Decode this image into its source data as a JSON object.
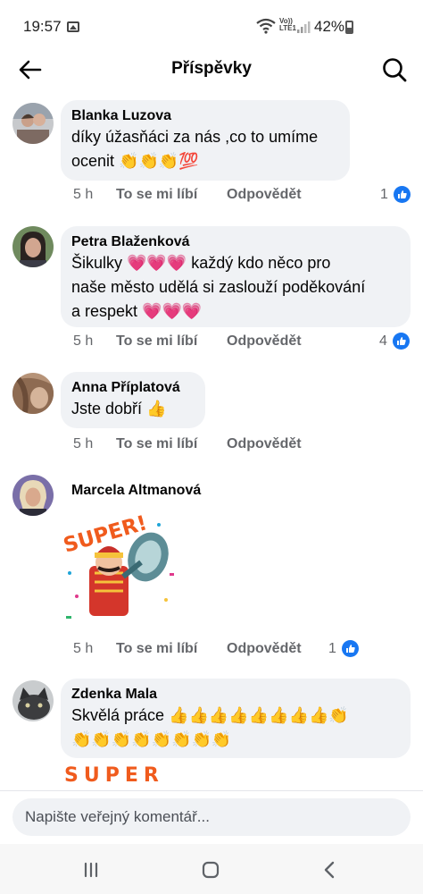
{
  "status_bar": {
    "time": "19:57",
    "volte": "Vo)) LTE1",
    "battery": "42%",
    "icons": [
      "gallery-icon",
      "wifi-icon",
      "signal-icon",
      "battery-icon"
    ]
  },
  "header": {
    "title": "Příspěvky",
    "back_icon": "arrow-left-icon",
    "search_icon": "search-icon"
  },
  "actions": {
    "like_label": "To se mi líbí",
    "reply_label": "Odpovědět"
  },
  "comments": [
    {
      "author": "Blanka Luzova",
      "text": "díky  úžasňáci za nás ,co to umíme\nocenit 👏👏👏💯",
      "time": "5 h",
      "reactions": "1"
    },
    {
      "author": "Petra Blaženková",
      "text": "Šikulky 💗💗💗  každý kdo něco pro\nnaše město udělá si zaslouží poděkování\na respekt 💗💗💗",
      "time": "5 h",
      "reactions": "4"
    },
    {
      "author": "Anna Příplatová",
      "text": "Jste dobří 👍",
      "time": "5 h"
    },
    {
      "author": "Marcela Altmanová",
      "sticker_text": "SUPER!",
      "time": "5 h",
      "reactions": "1"
    },
    {
      "author": "Zdenka Mala",
      "text": "Skvělá práce 👍👍👍👍👍👍👍👍👏\n👏👏👏👏👏👏👏👏",
      "sticker_text": "SUPER"
    }
  ],
  "composer": {
    "placeholder": "Napište veřejný komentář..."
  },
  "nav": {
    "icons": [
      "recent-apps-icon",
      "home-icon",
      "back-icon"
    ]
  },
  "colors": {
    "bubble": "#f0f2f5",
    "meta_text": "#65676b",
    "like_blue": "#1877f2"
  }
}
